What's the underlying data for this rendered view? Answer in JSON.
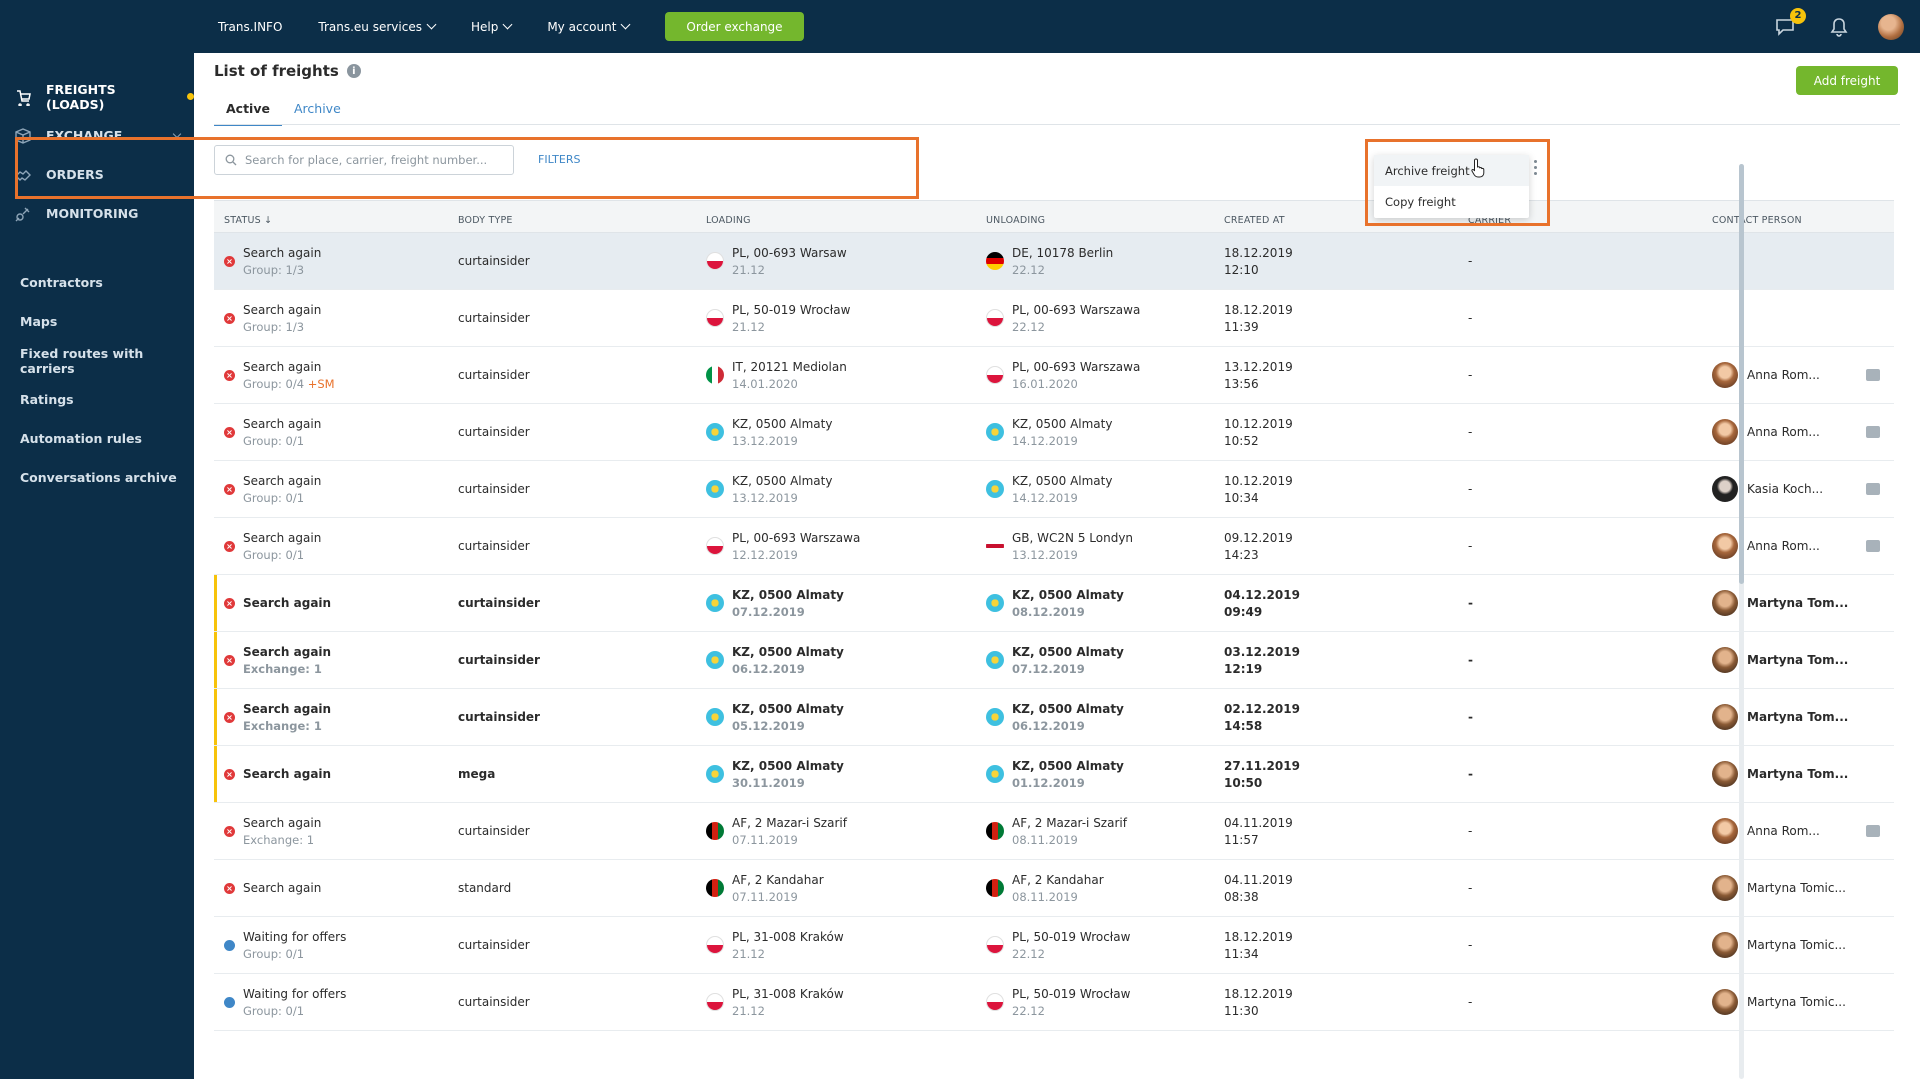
{
  "topnav": {
    "items": [
      "Trans.INFO",
      "Trans.eu services",
      "Help",
      "My account"
    ],
    "order_button": "Order exchange",
    "chat_badge": "2"
  },
  "sidebar": {
    "main": [
      {
        "label": "FREIGHTS (LOADS)",
        "icon": "freights-icon"
      },
      {
        "label": "EXCHANGE",
        "icon": "box-icon"
      },
      {
        "label": "ORDERS",
        "icon": "handshake-icon"
      },
      {
        "label": "MONITORING",
        "icon": "satellite-icon"
      }
    ],
    "sub": [
      "Contractors",
      "Maps",
      "Fixed routes with carriers",
      "Ratings",
      "Automation rules",
      "Conversations archive"
    ]
  },
  "page": {
    "title": "List of freights",
    "add_button": "Add freight",
    "tabs": [
      "Active",
      "Archive"
    ],
    "search_placeholder": "Search for place, carrier, freight number...",
    "filters": "FILTERS"
  },
  "table": {
    "headers": [
      "STATUS ↓",
      "BODY TYPE",
      "LOADING",
      "UNLOADING",
      "CREATED AT",
      "CARRIER",
      "CONTACT PERSON"
    ],
    "rows": [
      {
        "status": "Search again",
        "group": "Group: 1/3",
        "body": "curtainsider",
        "load": "PL, 00-693 Warsaw",
        "load_date": "21.12",
        "unload": "DE, 10178 Berlin",
        "unload_date": "22.12",
        "created": "18.12.2019",
        "time": "12:10",
        "carrier": "-",
        "contact": ""
      },
      {
        "status": "Search again",
        "group": "Group: 1/3",
        "body": "curtainsider",
        "load": "PL, 50-019 Wrocław",
        "load_date": "21.12",
        "unload": "PL, 00-693 Warszawa",
        "unload_date": "22.12",
        "created": "18.12.2019",
        "time": "11:39",
        "carrier": "-",
        "contact": ""
      },
      {
        "status": "Search again",
        "group": "Group: 0/4",
        "tag": "+SM",
        "body": "curtainsider",
        "load": "IT, 20121 Mediolan",
        "load_date": "14.01.2020",
        "unload": "PL, 00-693 Warszawa",
        "unload_date": "16.01.2020",
        "created": "13.12.2019",
        "time": "13:56",
        "carrier": "-",
        "contact": "Anna Rom..."
      },
      {
        "status": "Search again",
        "group": "Group: 0/1",
        "body": "curtainsider",
        "load": "KZ, 0500 Almaty",
        "load_date": "13.12.2019",
        "unload": "KZ, 0500 Almaty",
        "unload_date": "14.12.2019",
        "created": "10.12.2019",
        "time": "10:52",
        "carrier": "-",
        "contact": "Anna Rom..."
      },
      {
        "status": "Search again",
        "group": "Group: 0/1",
        "body": "curtainsider",
        "load": "KZ, 0500 Almaty",
        "load_date": "13.12.2019",
        "unload": "KZ, 0500 Almaty",
        "unload_date": "14.12.2019",
        "created": "10.12.2019",
        "time": "10:34",
        "carrier": "-",
        "contact": "Kasia Koch..."
      },
      {
        "status": "Search again",
        "group": "Group: 0/1",
        "body": "curtainsider",
        "load": "PL, 00-693 Warszawa",
        "load_date": "12.12.2019",
        "unload": "GB, WC2N 5 Londyn",
        "unload_date": "13.12.2019",
        "created": "09.12.2019",
        "time": "14:23",
        "carrier": "-",
        "contact": "Anna Rom..."
      },
      {
        "status": "Search again",
        "group": "",
        "body": "curtainsider",
        "load": "KZ, 0500 Almaty",
        "load_date": "07.12.2019",
        "unload": "KZ, 0500 Almaty",
        "unload_date": "08.12.2019",
        "created": "04.12.2019",
        "time": "09:49",
        "carrier": "-",
        "contact": "Martyna Tom..."
      },
      {
        "status": "Search again",
        "group": "Exchange: 1",
        "body": "curtainsider",
        "load": "KZ, 0500 Almaty",
        "load_date": "06.12.2019",
        "unload": "KZ, 0500 Almaty",
        "unload_date": "07.12.2019",
        "created": "03.12.2019",
        "time": "12:19",
        "carrier": "-",
        "contact": "Martyna Tom..."
      },
      {
        "status": "Search again",
        "group": "Exchange: 1",
        "body": "curtainsider",
        "load": "KZ, 0500 Almaty",
        "load_date": "05.12.2019",
        "unload": "KZ, 0500 Almaty",
        "unload_date": "06.12.2019",
        "created": "02.12.2019",
        "time": "14:58",
        "carrier": "-",
        "contact": "Martyna Tom..."
      },
      {
        "status": "Search again",
        "group": "",
        "body": "mega",
        "load": "KZ, 0500 Almaty",
        "load_date": "30.11.2019",
        "unload": "KZ, 0500 Almaty",
        "unload_date": "01.12.2019",
        "created": "27.11.2019",
        "time": "10:50",
        "carrier": "-",
        "contact": "Martyna Tom..."
      },
      {
        "status": "Search again",
        "group": "Exchange: 1",
        "body": "curtainsider",
        "load": "AF, 2 Mazar-i Szarif",
        "load_date": "07.11.2019",
        "unload": "AF, 2 Mazar-i Szarif",
        "unload_date": "08.11.2019",
        "created": "04.11.2019",
        "time": "11:57",
        "carrier": "-",
        "contact": "Anna Rom..."
      },
      {
        "status": "Search again",
        "group": "",
        "body": "standard",
        "load": "AF, 2 Kandahar",
        "load_date": "07.11.2019",
        "unload": "AF, 2 Kandahar",
        "unload_date": "08.11.2019",
        "created": "04.11.2019",
        "time": "08:38",
        "carrier": "-",
        "contact": "Martyna Tomic..."
      },
      {
        "status": "Waiting for offers",
        "group": "Group: 0/1",
        "body": "curtainsider",
        "load": "PL, 31-008 Kraków",
        "load_date": "21.12",
        "unload": "PL, 50-019 Wrocław",
        "unload_date": "22.12",
        "created": "18.12.2019",
        "time": "11:34",
        "carrier": "-",
        "contact": "Martyna Tomic..."
      },
      {
        "status": "Waiting for offers",
        "group": "Group: 0/1",
        "body": "curtainsider",
        "load": "PL, 31-008 Kraków",
        "load_date": "21.12",
        "unload": "PL, 50-019 Wrocław",
        "unload_date": "22.12",
        "created": "18.12.2019",
        "time": "11:30",
        "carrier": "-",
        "contact": "Martyna Tomic..."
      }
    ]
  },
  "context_menu": {
    "items": [
      "Archive freight",
      "Copy freight"
    ]
  }
}
